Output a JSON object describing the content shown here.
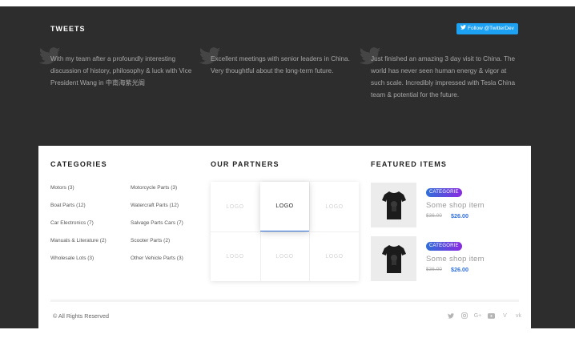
{
  "tweets": {
    "title": "TWEETS",
    "follow_label": "Follow @TwitterDev",
    "items": [
      {
        "text": "With my team after a profoundly interesting discussion of history, philosophy & luck with Vice President Wang in 中南海紫光阁"
      },
      {
        "text": "Excellent meetings with senior leaders in China. Very thoughtful about the long-term future."
      },
      {
        "text": "Just finished an amazing 3 day visit to China. The world has never seen human energy & vigor at such scale. Incredibly impressed with Tesla China team & potential for the future."
      }
    ]
  },
  "categories": {
    "title": "CATEGORIES",
    "items": [
      "Motors (3)",
      "Motorcycle Parts (3)",
      "Boat Parts (12)",
      "Watercraft Parts (12)",
      "Car Electronics (7)",
      "Salvage Parts Cars (7)",
      "Manuals & Literature (2)",
      "Scooter Parts (2)",
      "Wholesale Lots (3)",
      "Other Vehicle Parts (3)"
    ]
  },
  "partners": {
    "title": "OUR PARTNERS",
    "logos": [
      "LOGO",
      "LOGO",
      "LOGO",
      "LOGO",
      "LOGO",
      "LOGO"
    ]
  },
  "featured": {
    "title": "FEATURED ITEMS",
    "items": [
      {
        "badge": "CATEGORIE",
        "name": "Some shop item",
        "old_price": "$36.00",
        "price": "$26.00"
      },
      {
        "badge": "CATEGORIE",
        "name": "Some shop item",
        "old_price": "$36.00",
        "price": "$26.00"
      }
    ]
  },
  "footer": {
    "copyright": "© All Rights Reserved",
    "socials": [
      "twitter-icon",
      "instagram-icon",
      "google-plus-icon",
      "youtube-icon",
      "vimeo-icon",
      "vk-icon"
    ]
  }
}
